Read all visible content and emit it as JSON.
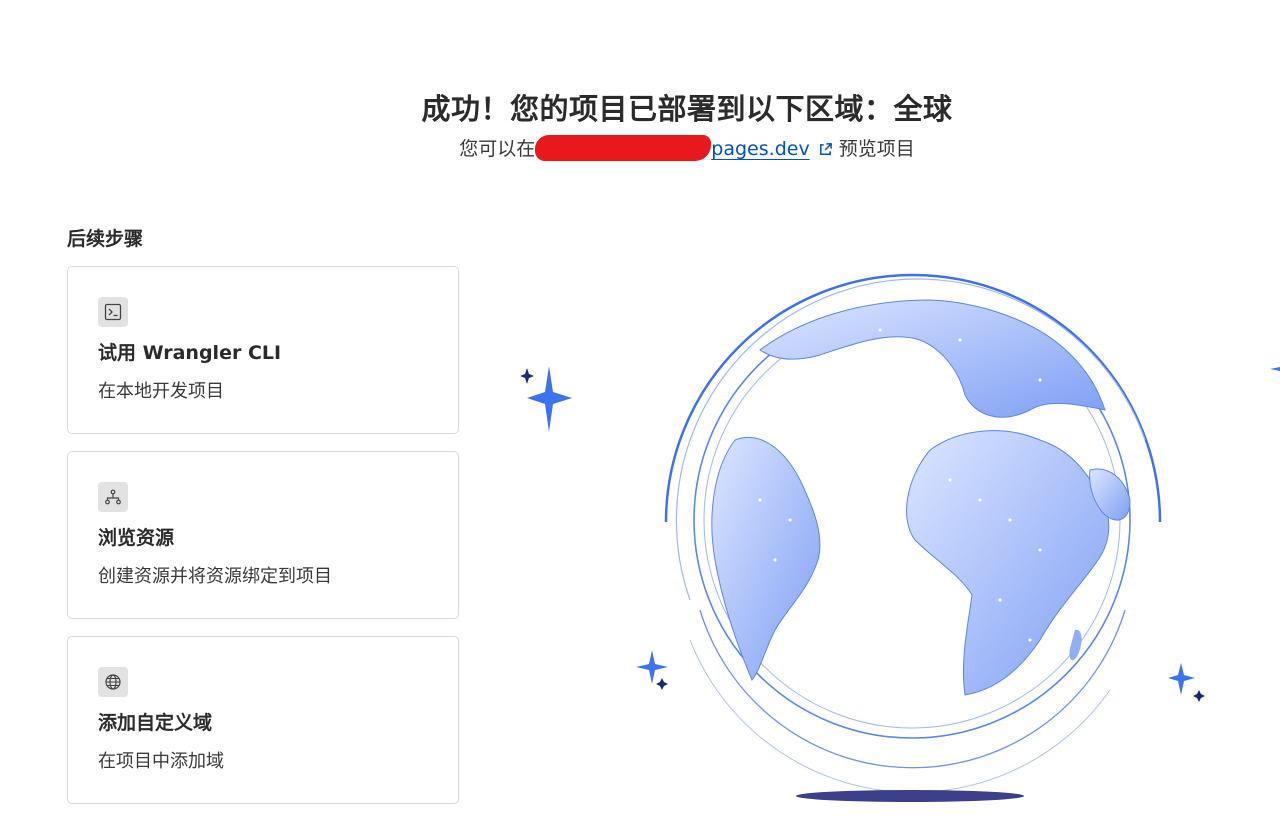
{
  "header": {
    "title": "成功！您的项目已部署到以下区域：全球",
    "preview_prefix": "您可以在",
    "preview_url_visible": "pages.dev",
    "preview_suffix": "预览项目"
  },
  "next_steps": {
    "heading": "后续步骤",
    "cards": [
      {
        "icon": "terminal-icon",
        "title": "试用 Wrangler CLI",
        "description": "在本地开发项目"
      },
      {
        "icon": "network-tree-icon",
        "title": "浏览资源",
        "description": "创建资源并将资源绑定到项目"
      },
      {
        "icon": "globe-icon",
        "title": "添加自定义域",
        "description": "在项目中添加域"
      }
    ]
  },
  "colors": {
    "link": "#0051c3",
    "redaction": "#e8191c",
    "globe_ocean": "#ffffff",
    "globe_land": "#8fb0f7",
    "globe_outline": "#3b6fe0",
    "sparkle": "#3c73f0",
    "shadow": "#3b3f8c"
  }
}
